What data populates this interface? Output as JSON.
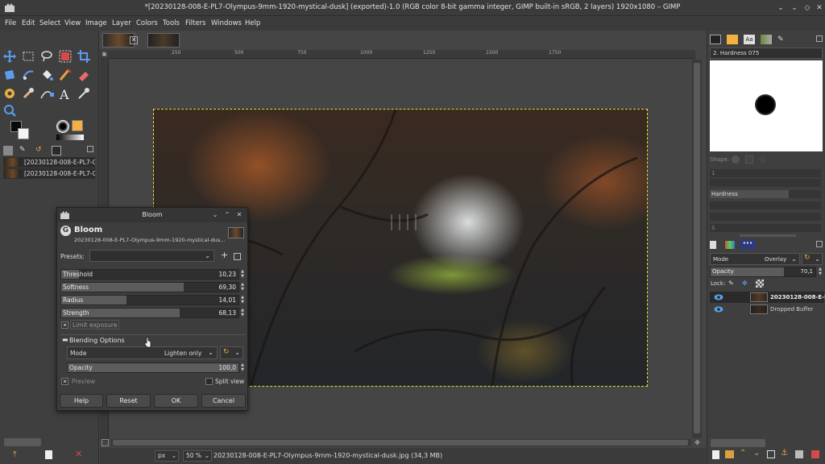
{
  "window": {
    "title": "*[20230128-008-E-PL7-Olympus-9mm-1920-mystical-dusk] (exported)-1.0 (RGB color 8-bit gamma integer, GIMP built-in sRGB, 2 layers) 1920x1080 – GIMP"
  },
  "menu": [
    "File",
    "Edit",
    "Select",
    "View",
    "Image",
    "Layer",
    "Colors",
    "Tools",
    "Filters",
    "Windows",
    "Help"
  ],
  "images_panel": {
    "items": [
      "[20230128-008-E-PL7-Olym",
      "[20230128-008-E-PL7-Olym"
    ]
  },
  "ruler": {
    "h_ticks": [
      "250",
      "500",
      "750",
      "1000",
      "1250",
      "1500",
      "1750"
    ]
  },
  "bloom_dialog": {
    "window_title": "Bloom",
    "heading": "Bloom",
    "subtitle": "20230128-008-E-PL7-Olympus-9mm-1920-mystical-dus...",
    "presets_label": "Presets:",
    "sliders": [
      {
        "name": "Threshold",
        "value": "10,23",
        "fraction": 0.1
      },
      {
        "name": "Softness",
        "value": "69,30",
        "fraction": 0.69
      },
      {
        "name": "Radius",
        "value": "14,01",
        "fraction": 0.37
      },
      {
        "name": "Strength",
        "value": "68,13",
        "fraction": 0.67
      }
    ],
    "limit_exposure": "Limit exposure",
    "blending_options": "Blending Options",
    "mode_label": "Mode",
    "mode_value": "Lighten only",
    "opacity_label": "Opacity",
    "opacity_value": "100,0",
    "preview_label": "Preview",
    "split_view_label": "Split view",
    "buttons": {
      "help": "Help",
      "reset": "Reset",
      "ok": "OK",
      "cancel": "Cancel"
    }
  },
  "status": {
    "unit": "px",
    "zoom": "50 %",
    "file_info": "20230128-008-E-PL7-Olympus-9mm-1920-mystical-dusk.jpg (34,3 MB)"
  },
  "brush_panel": {
    "brush_name": "2. Hardness 075",
    "shape_label": "Shape:",
    "hardness_label": "Hardness"
  },
  "layers_panel": {
    "mode_label": "Mode",
    "mode_value": "Overlay",
    "opacity_label": "Opacity",
    "opacity_value": "70,1",
    "lock_label": "Lock:",
    "layers": [
      {
        "name": "20230128-008-E-PL7",
        "active": true
      },
      {
        "name": "Dropped Buffer",
        "active": false
      }
    ]
  }
}
